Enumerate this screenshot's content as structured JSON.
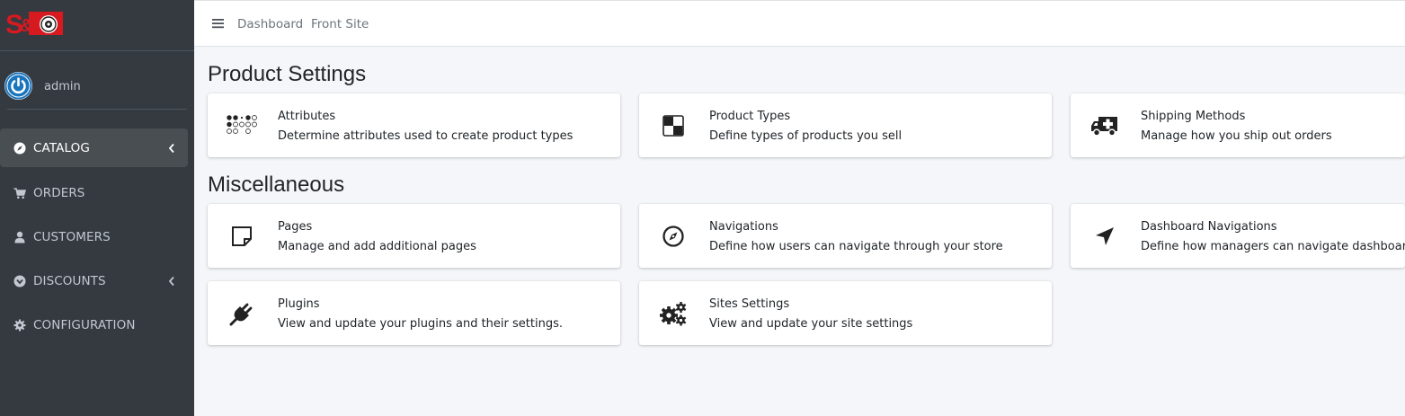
{
  "sidebar": {
    "user": {
      "name": "admin"
    },
    "items": [
      {
        "label": "CATALOG",
        "icon": "compass-icon",
        "active": true,
        "has_children": true
      },
      {
        "label": "ORDERS",
        "icon": "cart-icon",
        "active": false,
        "has_children": false
      },
      {
        "label": "CUSTOMERS",
        "icon": "user-icon",
        "active": false,
        "has_children": false
      },
      {
        "label": "DISCOUNTS",
        "icon": "tag-circle-icon",
        "active": false,
        "has_children": true
      },
      {
        "label": "CONFIGURATION",
        "icon": "gear-icon",
        "active": false,
        "has_children": false
      }
    ]
  },
  "topbar": {
    "links": [
      {
        "label": "Dashboard"
      },
      {
        "label": "Front Site"
      }
    ]
  },
  "sections": [
    {
      "title": "Product Settings",
      "cards": [
        {
          "title": "Attributes",
          "description": "Determine attributes used to create product types",
          "icon": "dots-grid-icon"
        },
        {
          "title": "Product Types",
          "description": "Define types of products you sell",
          "icon": "checker-square-icon"
        },
        {
          "title": "Shipping Methods",
          "description": "Manage how you ship out orders",
          "icon": "ambulance-truck-icon"
        }
      ]
    },
    {
      "title": "Miscellaneous",
      "cards": [
        {
          "title": "Pages",
          "description": "Manage and add additional pages",
          "icon": "sticky-note-icon"
        },
        {
          "title": "Navigations",
          "description": "Define how users can navigate through your store",
          "icon": "compass-outline-icon"
        },
        {
          "title": "Dashboard Navigations",
          "description": "Define how managers can navigate dashboard",
          "icon": "location-arrow-icon"
        },
        {
          "title": "Plugins",
          "description": "View and update your plugins and their settings.",
          "icon": "plug-icon"
        },
        {
          "title": "Sites Settings",
          "description": "View and update your site settings",
          "icon": "gears-icon"
        }
      ]
    }
  ],
  "colors": {
    "sidebar_bg": "#343a40",
    "sidebar_active_bg": "#494e53",
    "sidebar_text": "#c2c7d0",
    "content_bg": "#f4f6f9",
    "avatar_blue": "#1b75bc",
    "logo_red": "#d71920"
  }
}
